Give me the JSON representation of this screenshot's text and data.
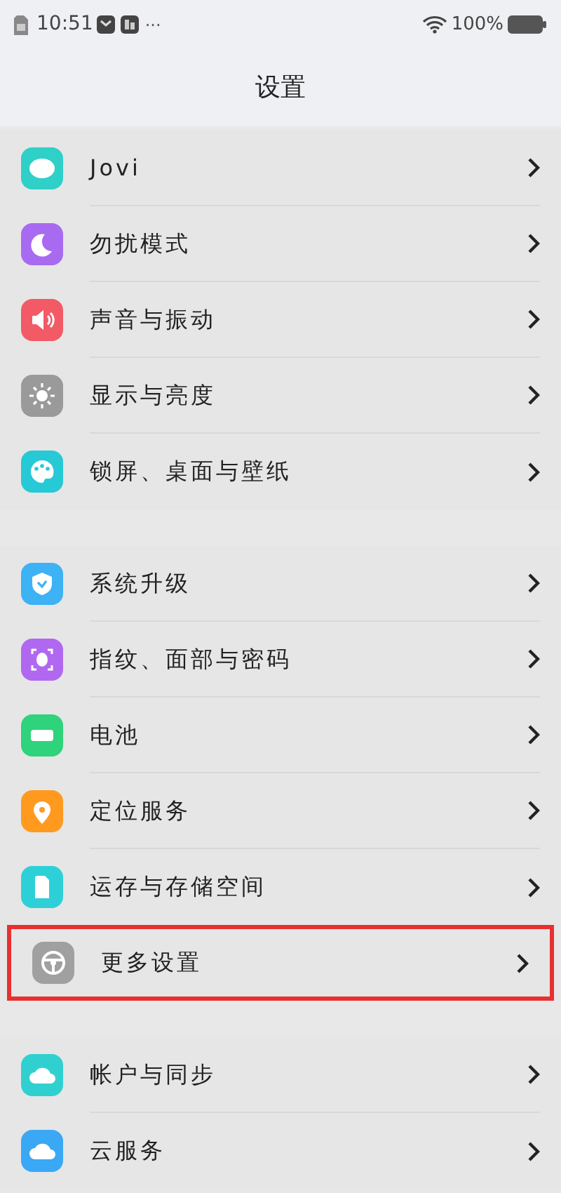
{
  "status_bar": {
    "time": "10:51",
    "more": "···",
    "battery": "100%"
  },
  "title": "设置",
  "groups": [
    {
      "items": [
        {
          "label": "Jovi",
          "kind": "jovi",
          "highlighted": false
        },
        {
          "label": "勿扰模式",
          "kind": "moon",
          "highlighted": false
        },
        {
          "label": "声音与振动",
          "kind": "speaker",
          "highlighted": false
        },
        {
          "label": "显示与亮度",
          "kind": "sun",
          "highlighted": false
        },
        {
          "label": "锁屏、桌面与壁纸",
          "kind": "palette",
          "highlighted": false
        }
      ]
    },
    {
      "items": [
        {
          "label": "系统升级",
          "kind": "shield",
          "highlighted": false
        },
        {
          "label": "指纹、面部与密码",
          "kind": "face",
          "highlighted": false
        },
        {
          "label": "电池",
          "kind": "battery",
          "highlighted": false
        },
        {
          "label": "定位服务",
          "kind": "location",
          "highlighted": false
        },
        {
          "label": "运存与存储空间",
          "kind": "storage",
          "highlighted": false
        },
        {
          "label": "更多设置",
          "kind": "wheel",
          "highlighted": true
        }
      ]
    },
    {
      "items": [
        {
          "label": "帐户与同步",
          "kind": "cloud-sync",
          "highlighted": false
        },
        {
          "label": "云服务",
          "kind": "cloud",
          "highlighted": false
        }
      ]
    }
  ]
}
